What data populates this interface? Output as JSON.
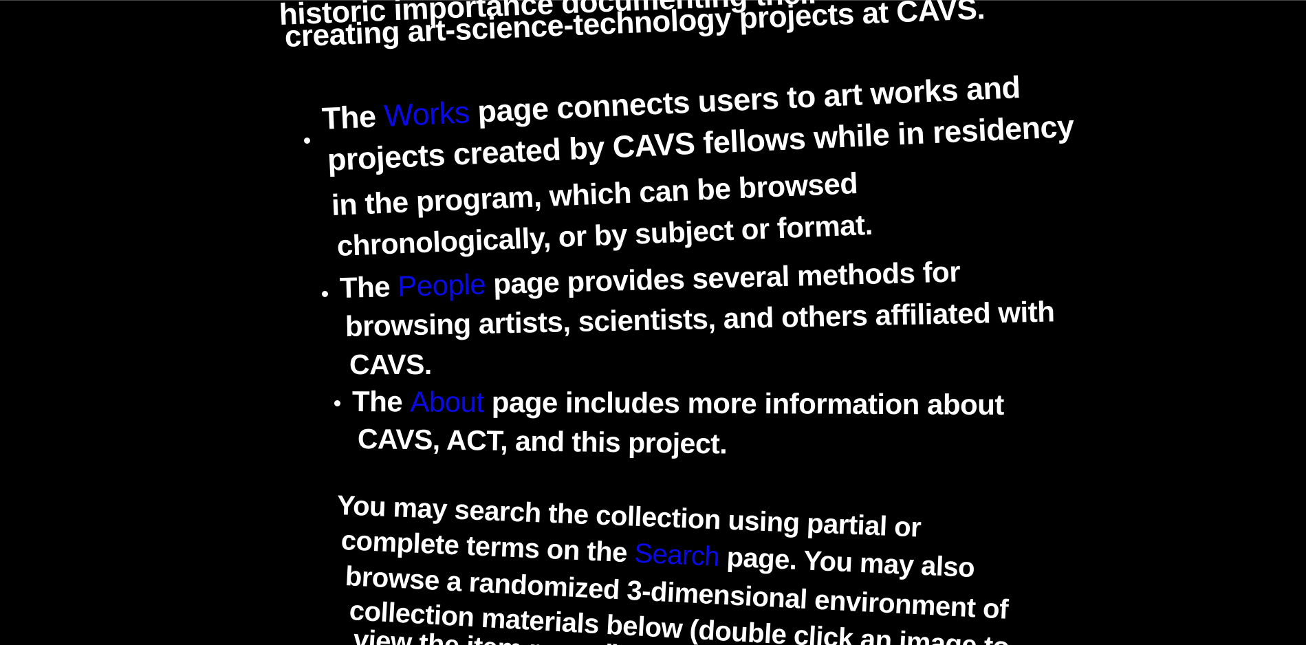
{
  "intro": {
    "line1": "historic importance documenting their",
    "line2": "creating art-science-technology projects at CAVS."
  },
  "bullets": [
    {
      "before": "The ",
      "link": "Works",
      "after": " page connects users to art works and",
      "line2": "projects created by CAVS fellows while in residency",
      "line3": "in the program, which can be browsed",
      "line4": "chronologically, or by subject or format."
    },
    {
      "before": "The ",
      "link": "People",
      "after": " page provides several methods for",
      "line2": "browsing artists, scientists, and others affiliated with",
      "line3": "CAVS."
    },
    {
      "before": "The ",
      "link": "About",
      "after": " page includes more information about",
      "line2": "CAVS, ACT, and this project."
    }
  ],
  "search_paragraph": {
    "line1": "You may search the collection using partial or",
    "line2_before": "complete terms on the ",
    "line2_link": "Search",
    "line2_after": " page. You may also",
    "line3": "browse a randomized 3-dimensional environment of",
    "line4": "collection materials below (double click an image to",
    "line5": "view the item record)."
  },
  "colors": {
    "background": "#000000",
    "text": "#ffffff",
    "link": "#0a0ae6"
  }
}
